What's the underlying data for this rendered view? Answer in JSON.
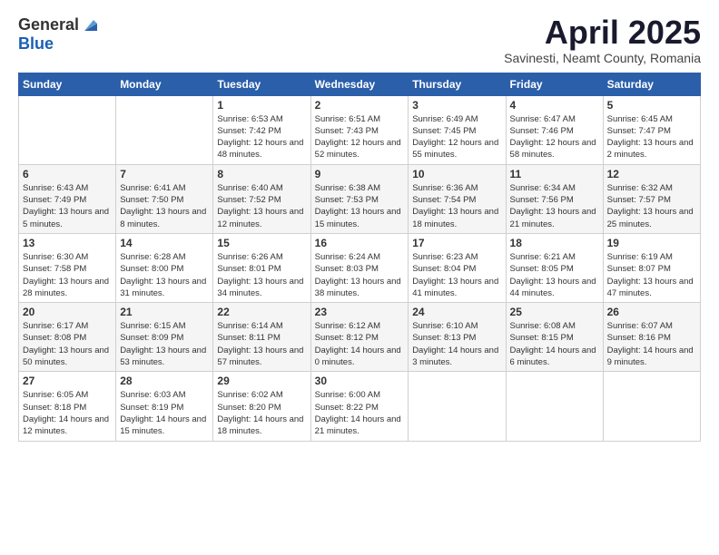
{
  "logo": {
    "general": "General",
    "blue": "Blue"
  },
  "title": "April 2025",
  "subtitle": "Savinesti, Neamt County, Romania",
  "days_header": [
    "Sunday",
    "Monday",
    "Tuesday",
    "Wednesday",
    "Thursday",
    "Friday",
    "Saturday"
  ],
  "weeks": [
    [
      {
        "day": "",
        "info": ""
      },
      {
        "day": "",
        "info": ""
      },
      {
        "day": "1",
        "info": "Sunrise: 6:53 AM\nSunset: 7:42 PM\nDaylight: 12 hours\nand 48 minutes."
      },
      {
        "day": "2",
        "info": "Sunrise: 6:51 AM\nSunset: 7:43 PM\nDaylight: 12 hours\nand 52 minutes."
      },
      {
        "day": "3",
        "info": "Sunrise: 6:49 AM\nSunset: 7:45 PM\nDaylight: 12 hours\nand 55 minutes."
      },
      {
        "day": "4",
        "info": "Sunrise: 6:47 AM\nSunset: 7:46 PM\nDaylight: 12 hours\nand 58 minutes."
      },
      {
        "day": "5",
        "info": "Sunrise: 6:45 AM\nSunset: 7:47 PM\nDaylight: 13 hours\nand 2 minutes."
      }
    ],
    [
      {
        "day": "6",
        "info": "Sunrise: 6:43 AM\nSunset: 7:49 PM\nDaylight: 13 hours\nand 5 minutes."
      },
      {
        "day": "7",
        "info": "Sunrise: 6:41 AM\nSunset: 7:50 PM\nDaylight: 13 hours\nand 8 minutes."
      },
      {
        "day": "8",
        "info": "Sunrise: 6:40 AM\nSunset: 7:52 PM\nDaylight: 13 hours\nand 12 minutes."
      },
      {
        "day": "9",
        "info": "Sunrise: 6:38 AM\nSunset: 7:53 PM\nDaylight: 13 hours\nand 15 minutes."
      },
      {
        "day": "10",
        "info": "Sunrise: 6:36 AM\nSunset: 7:54 PM\nDaylight: 13 hours\nand 18 minutes."
      },
      {
        "day": "11",
        "info": "Sunrise: 6:34 AM\nSunset: 7:56 PM\nDaylight: 13 hours\nand 21 minutes."
      },
      {
        "day": "12",
        "info": "Sunrise: 6:32 AM\nSunset: 7:57 PM\nDaylight: 13 hours\nand 25 minutes."
      }
    ],
    [
      {
        "day": "13",
        "info": "Sunrise: 6:30 AM\nSunset: 7:58 PM\nDaylight: 13 hours\nand 28 minutes."
      },
      {
        "day": "14",
        "info": "Sunrise: 6:28 AM\nSunset: 8:00 PM\nDaylight: 13 hours\nand 31 minutes."
      },
      {
        "day": "15",
        "info": "Sunrise: 6:26 AM\nSunset: 8:01 PM\nDaylight: 13 hours\nand 34 minutes."
      },
      {
        "day": "16",
        "info": "Sunrise: 6:24 AM\nSunset: 8:03 PM\nDaylight: 13 hours\nand 38 minutes."
      },
      {
        "day": "17",
        "info": "Sunrise: 6:23 AM\nSunset: 8:04 PM\nDaylight: 13 hours\nand 41 minutes."
      },
      {
        "day": "18",
        "info": "Sunrise: 6:21 AM\nSunset: 8:05 PM\nDaylight: 13 hours\nand 44 minutes."
      },
      {
        "day": "19",
        "info": "Sunrise: 6:19 AM\nSunset: 8:07 PM\nDaylight: 13 hours\nand 47 minutes."
      }
    ],
    [
      {
        "day": "20",
        "info": "Sunrise: 6:17 AM\nSunset: 8:08 PM\nDaylight: 13 hours\nand 50 minutes."
      },
      {
        "day": "21",
        "info": "Sunrise: 6:15 AM\nSunset: 8:09 PM\nDaylight: 13 hours\nand 53 minutes."
      },
      {
        "day": "22",
        "info": "Sunrise: 6:14 AM\nSunset: 8:11 PM\nDaylight: 13 hours\nand 57 minutes."
      },
      {
        "day": "23",
        "info": "Sunrise: 6:12 AM\nSunset: 8:12 PM\nDaylight: 14 hours\nand 0 minutes."
      },
      {
        "day": "24",
        "info": "Sunrise: 6:10 AM\nSunset: 8:13 PM\nDaylight: 14 hours\nand 3 minutes."
      },
      {
        "day": "25",
        "info": "Sunrise: 6:08 AM\nSunset: 8:15 PM\nDaylight: 14 hours\nand 6 minutes."
      },
      {
        "day": "26",
        "info": "Sunrise: 6:07 AM\nSunset: 8:16 PM\nDaylight: 14 hours\nand 9 minutes."
      }
    ],
    [
      {
        "day": "27",
        "info": "Sunrise: 6:05 AM\nSunset: 8:18 PM\nDaylight: 14 hours\nand 12 minutes."
      },
      {
        "day": "28",
        "info": "Sunrise: 6:03 AM\nSunset: 8:19 PM\nDaylight: 14 hours\nand 15 minutes."
      },
      {
        "day": "29",
        "info": "Sunrise: 6:02 AM\nSunset: 8:20 PM\nDaylight: 14 hours\nand 18 minutes."
      },
      {
        "day": "30",
        "info": "Sunrise: 6:00 AM\nSunset: 8:22 PM\nDaylight: 14 hours\nand 21 minutes."
      },
      {
        "day": "",
        "info": ""
      },
      {
        "day": "",
        "info": ""
      },
      {
        "day": "",
        "info": ""
      }
    ]
  ]
}
